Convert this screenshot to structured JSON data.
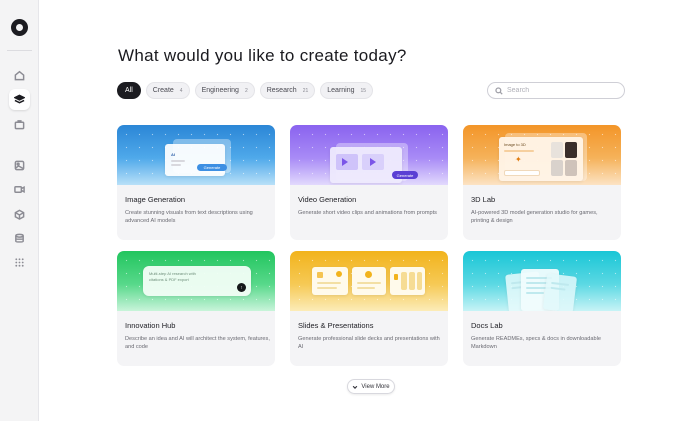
{
  "sidebar": {
    "items": [
      {
        "icon": "home-icon"
      },
      {
        "icon": "layers-icon",
        "active": true
      },
      {
        "icon": "briefcase-icon"
      },
      {
        "icon": "image-icon"
      },
      {
        "icon": "video-icon"
      },
      {
        "icon": "cube-icon"
      },
      {
        "icon": "database-icon"
      },
      {
        "icon": "grid-icon"
      }
    ]
  },
  "main": {
    "title": "What would you like to create today?",
    "filters": [
      {
        "label": "All",
        "count": "",
        "active": true
      },
      {
        "label": "Create",
        "count": "4"
      },
      {
        "label": "Engineering",
        "count": "2"
      },
      {
        "label": "Research",
        "count": "21"
      },
      {
        "label": "Learning",
        "count": "15"
      }
    ],
    "search": {
      "placeholder": "Search"
    },
    "cards": [
      {
        "title": "Image Generation",
        "description": "Create stunning visuals from text descriptions using advanced AI models",
        "accent": "#2b86d6",
        "banner_text": [
          "AI",
          "Generate"
        ]
      },
      {
        "title": "Video Generation",
        "description": "Generate short video clips and animations from prompts",
        "accent": "#8a63ef",
        "banner_text": [
          "Generate"
        ]
      },
      {
        "title": "3D Lab",
        "description": "AI-powered 3D model generation studio for games, printing & design",
        "accent": "#f39528",
        "banner_text": [
          "Image to 3D"
        ]
      },
      {
        "title": "Innovation Hub",
        "description": "Describe an idea and AI will architect the system, features, and code",
        "accent": "#22c55e",
        "banner_text": [
          "Multi-step AI research with citations & PDF export"
        ]
      },
      {
        "title": "Slides & Presentations",
        "description": "Generate professional slide decks and presentations with AI",
        "accent": "#f2b31c"
      },
      {
        "title": "Docs Lab",
        "description": "Generate READMEs, specs & docs in downloadable Markdown",
        "accent": "#19c6d6"
      }
    ],
    "view_more_label": "View More"
  }
}
